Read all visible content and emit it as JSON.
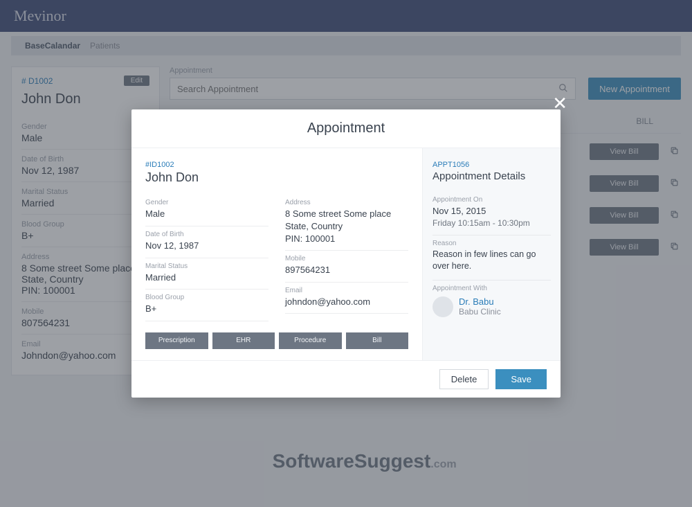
{
  "brand": "Mevinor",
  "crumbs": {
    "active": "BaseCalandar",
    "next": "Patients"
  },
  "sidepanel": {
    "id": "# D1002",
    "edit": "Edit",
    "name": "John Don",
    "fields": [
      {
        "label": "Gender",
        "value": "Male"
      },
      {
        "label": "Date of Birth",
        "value": "Nov 12, 1987"
      },
      {
        "label": "Marital Status",
        "value": "Married"
      },
      {
        "label": "Blood Group",
        "value": "B+"
      },
      {
        "label": "Address",
        "value": "8 Some street Some place\nState, Country\nPIN: 100001"
      },
      {
        "label": "Mobile",
        "value": "807564231"
      },
      {
        "label": "Email",
        "value": "Johndon@yahoo.com"
      }
    ]
  },
  "main": {
    "search_label": "Appointment",
    "search_placeholder": "Search Appointment",
    "new_btn": "New Appointment",
    "bill_header": "BILL",
    "view_bill": "View Bill"
  },
  "watermark": {
    "main": "SoftwareSuggest",
    "suffix": ".com"
  },
  "modal": {
    "title": "Appointment",
    "left": {
      "id": "#ID1002",
      "name": "John Don",
      "col1": [
        {
          "label": "Gender",
          "value": "Male"
        },
        {
          "label": "Date of Birth",
          "value": "Nov 12, 1987"
        },
        {
          "label": "Marital Status",
          "value": "Married"
        },
        {
          "label": "Blood Group",
          "value": "B+"
        }
      ],
      "col2": [
        {
          "label": "Address",
          "value": "8 Some street Some place\nState, Country\nPIN: 100001"
        },
        {
          "label": "Mobile",
          "value": "897564231"
        },
        {
          "label": "Email",
          "value": "johndon@yahoo.com"
        }
      ],
      "tabs": [
        "Prescription",
        "EHR",
        "Procedure",
        "Bill"
      ]
    },
    "right": {
      "id": "APPT1056",
      "title": "Appointment Details",
      "appt_on_label": "Appointment On",
      "date": "Nov 15, 2015",
      "time": "Friday 10:15am - 10:30pm",
      "reason_label": "Reason",
      "reason": "Reason in few lines can go over here.",
      "with_label": "Appointment With",
      "doctor": "Dr. Babu",
      "clinic": "Babu Clinic"
    },
    "footer": {
      "delete": "Delete",
      "save": "Save"
    }
  }
}
